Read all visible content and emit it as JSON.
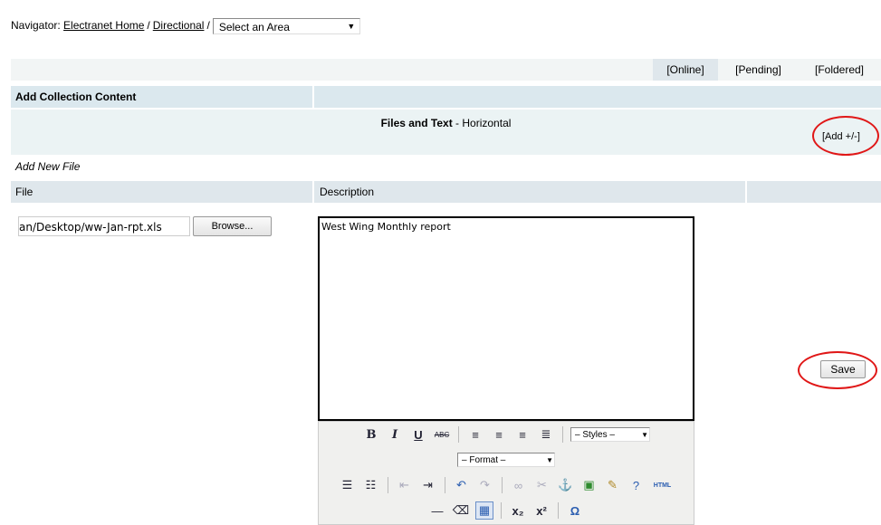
{
  "nav": {
    "label": "Navigator:",
    "home": "Electranet Home",
    "separator": "/",
    "directional": "Directional",
    "area_select": "Select an Area"
  },
  "tabs": [
    "[Online]",
    "[Pending]",
    "[Foldered]"
  ],
  "header": {
    "title": "Add Collection Content"
  },
  "section": {
    "title_bold": "Files and Text",
    "title_rest": " - Horizontal",
    "add_label": "[Add +/-]"
  },
  "subheading": "Add New File",
  "columns": {
    "file": "File",
    "description": "Description"
  },
  "file_input": {
    "value": "an/Desktop/ww-Jan-rpt.xls"
  },
  "browse_label": "Browse...",
  "description_text": "West Wing Monthly report",
  "save_label": "Save",
  "editor": {
    "styles_select": "– Styles –",
    "format_select": "– Format –",
    "html_label": "HTML"
  },
  "annotation_color": "#e01717"
}
